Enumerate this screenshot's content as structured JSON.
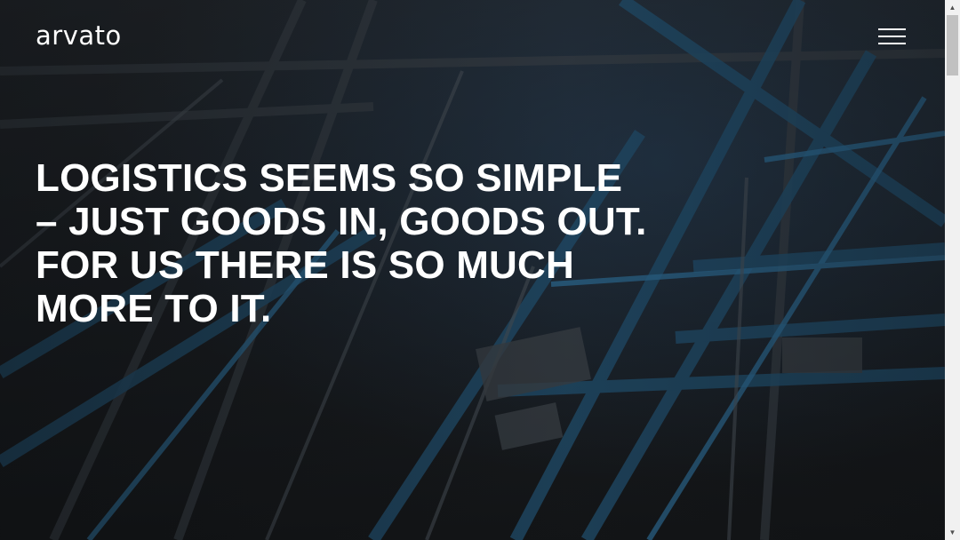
{
  "header": {
    "logo_text": "arvato",
    "menu_icon": "hamburger-menu-icon"
  },
  "hero": {
    "headline_lines": [
      "LOGISTICS SEEMS SO SIMPLE",
      "– JUST GOODS IN, GOODS OUT.",
      "FOR US THERE IS SO MUCH",
      "MORE TO IT."
    ],
    "background": "warehouse-racking-photo"
  },
  "scrollbar": {
    "up_icon": "scroll-up-arrow-icon",
    "down_icon": "scroll-down-arrow-icon"
  },
  "colors": {
    "text": "#ffffff",
    "accent_blue": "#1f4f7a",
    "background": "#1a1d21"
  }
}
